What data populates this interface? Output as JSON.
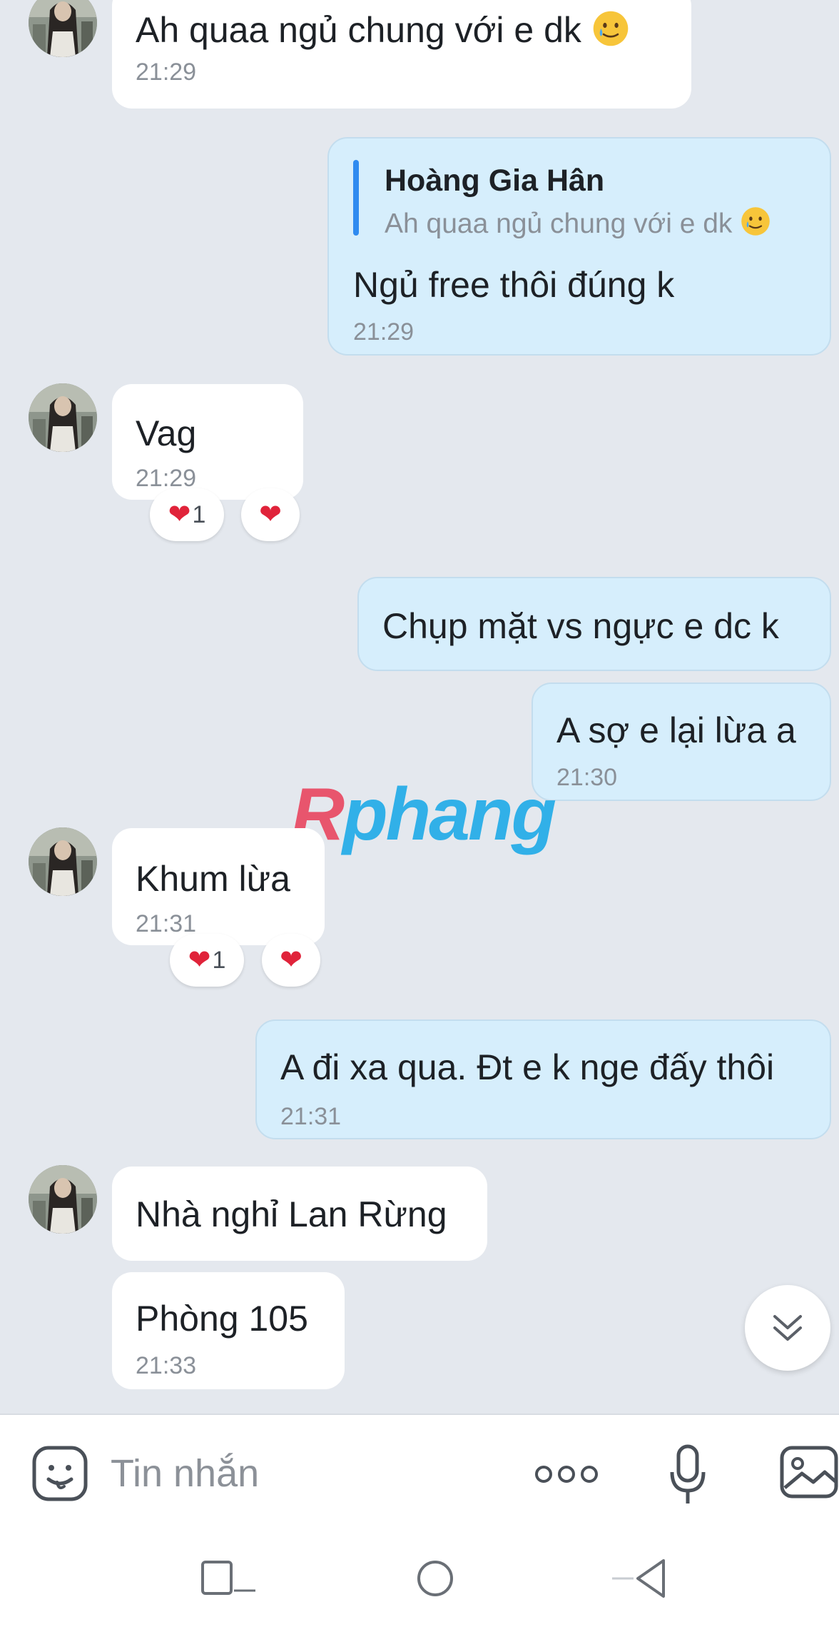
{
  "messages": [
    {
      "text": "Ah quaa ngủ chung với e dk",
      "time": "21:29"
    },
    {
      "quote_name": "Hoàng Gia Hân",
      "quote_text": "Ah quaa ngủ chung với e dk",
      "text": "Ngủ free thôi đúng k",
      "time": "21:29"
    },
    {
      "text": "Vag",
      "time": "21:29",
      "reaction_count": "1"
    },
    {
      "text": "Chụp mặt vs ngực e dc k"
    },
    {
      "text": "A sợ e lại lừa a",
      "time": "21:30"
    },
    {
      "text": "Khum lừa",
      "time": "21:31",
      "reaction_count": "1"
    },
    {
      "text": "A đi xa qua. Đt e k nge đấy thôi",
      "time": "21:31"
    },
    {
      "text": "Nhà nghỉ Lan Rừng"
    },
    {
      "text": "Phòng 105",
      "time": "21:33"
    }
  ],
  "watermark": {
    "part1": "R",
    "part2": "phang"
  },
  "composer": {
    "placeholder": "Tin nhắn"
  },
  "icons": {
    "sticker": "sticker-icon",
    "more": "more-dots-icon",
    "mic": "microphone-icon",
    "image": "image-icon",
    "scroll": "chevron-double-down-icon",
    "nav_recent": "recent-apps-icon",
    "nav_home": "home-icon",
    "nav_back": "back-icon"
  },
  "colors": {
    "background": "#e4e8ee",
    "incoming": "#ffffff",
    "outgoing": "#d6eefc",
    "quote_accent": "#2f8bf0",
    "heart": "#e0233a"
  }
}
